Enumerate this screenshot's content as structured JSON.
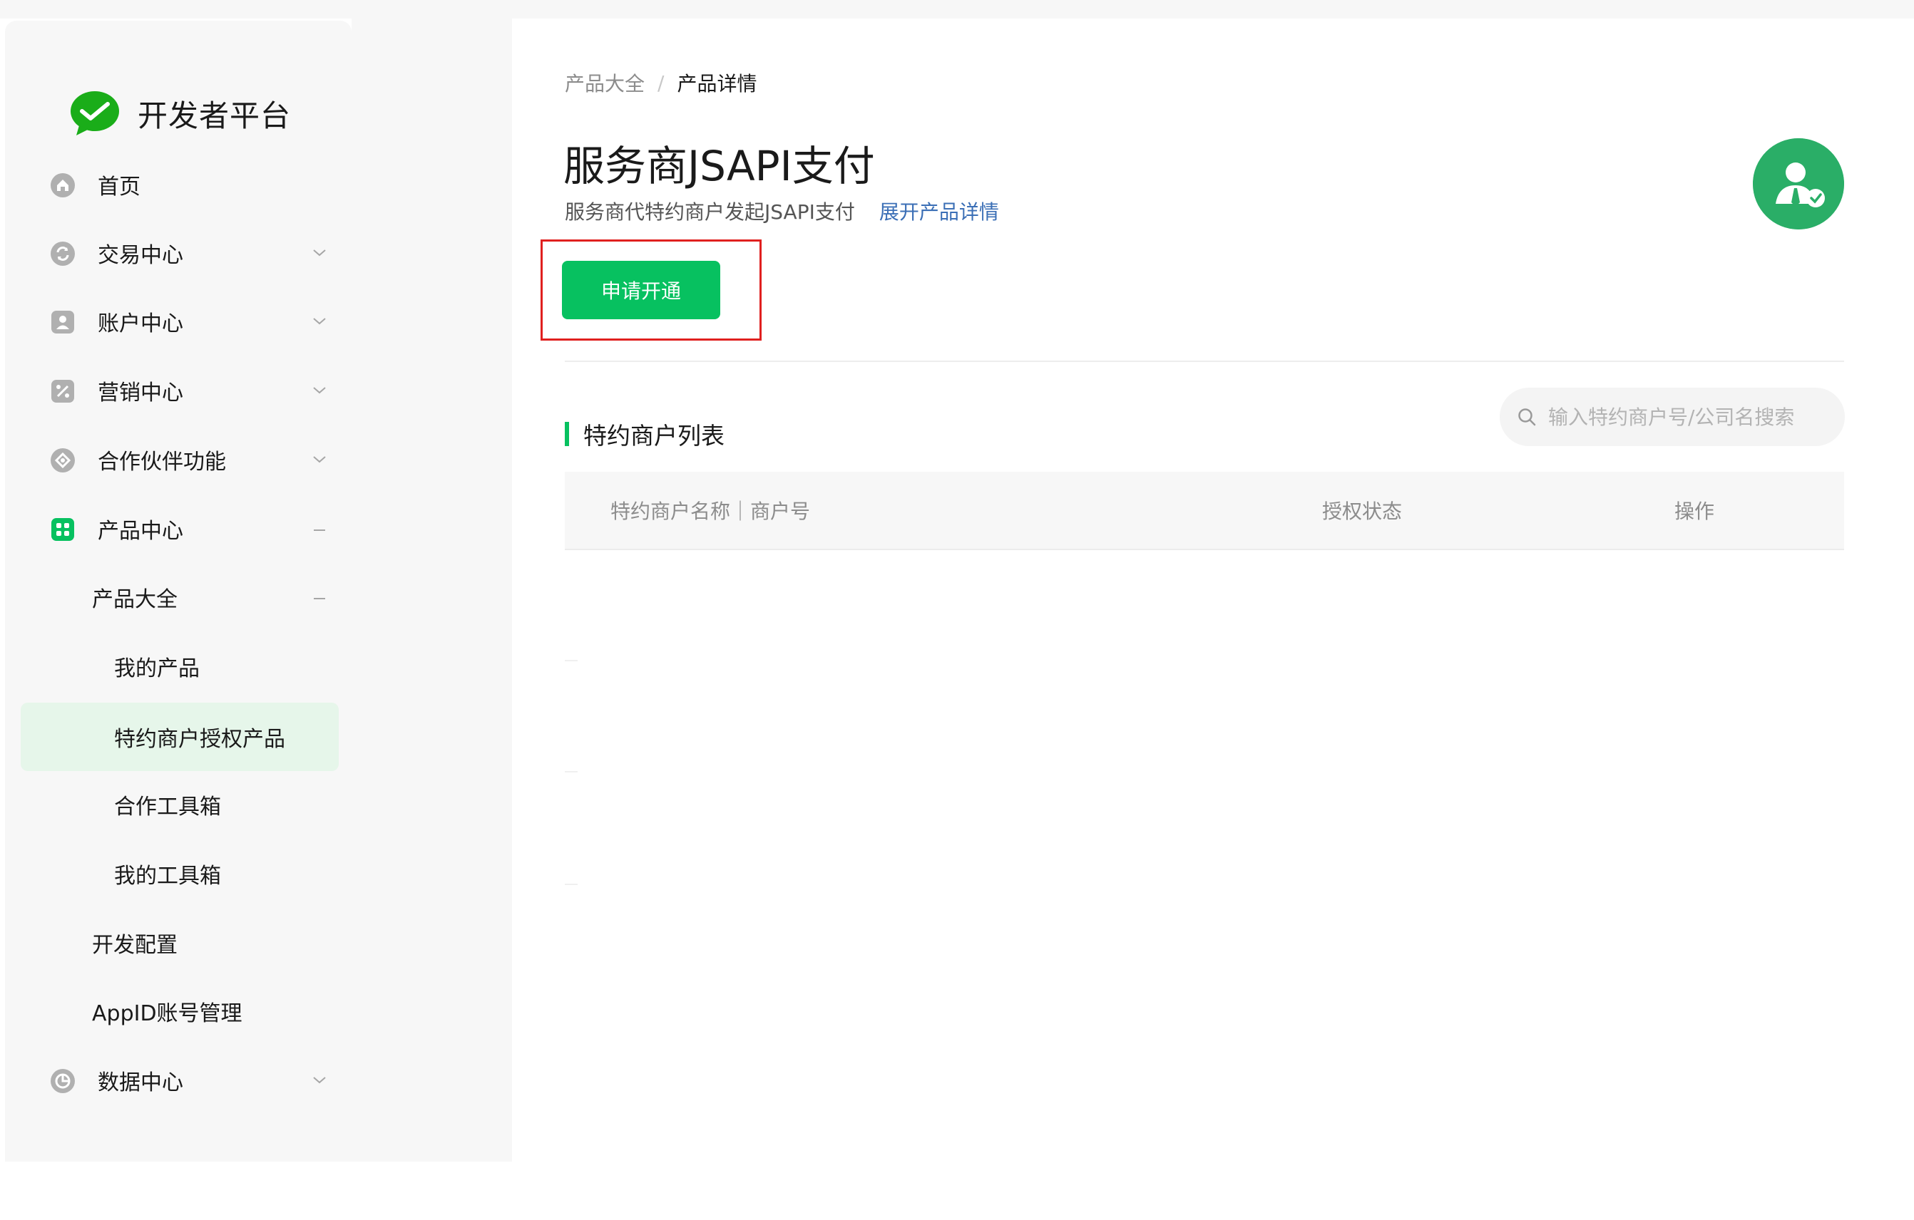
{
  "brand": {
    "name": "开发者平台"
  },
  "sidebar": {
    "items": [
      {
        "label": "首页",
        "icon": "home-icon"
      },
      {
        "label": "交易中心",
        "icon": "exchange-icon"
      },
      {
        "label": "账户中心",
        "icon": "account-icon"
      },
      {
        "label": "营销中心",
        "icon": "percent-icon"
      },
      {
        "label": "合作伙伴功能",
        "icon": "handshake-icon"
      },
      {
        "label": "产品中心",
        "icon": "grid-icon"
      },
      {
        "label": "产品大全"
      },
      {
        "label": "我的产品"
      },
      {
        "label": "特约商户授权产品"
      },
      {
        "label": "合作工具箱"
      },
      {
        "label": "我的工具箱"
      },
      {
        "label": "开发配置"
      },
      {
        "label": "AppID账号管理"
      },
      {
        "label": "数据中心",
        "icon": "pie-chart-icon"
      }
    ],
    "active_item": "特约商户授权产品"
  },
  "breadcrumb": {
    "parent": "产品大全",
    "separator": "/",
    "current": "产品详情"
  },
  "product": {
    "title": "服务商JSAPI支付",
    "subtitle": "服务商代特约商户发起JSAPI支付",
    "expand_link": "展开产品详情",
    "apply_button": "申请开通"
  },
  "merchant_section": {
    "title": "特约商户列表",
    "search_placeholder": "输入特约商户号/公司名搜索",
    "columns": [
      "特约商户名称｜商户号",
      "授权状态",
      "操作"
    ],
    "rows": []
  },
  "colors": {
    "accent": "#07c160",
    "active_bg": "#e6f6ea",
    "link": "#3b6fb6",
    "highlight": "#e0201f"
  }
}
